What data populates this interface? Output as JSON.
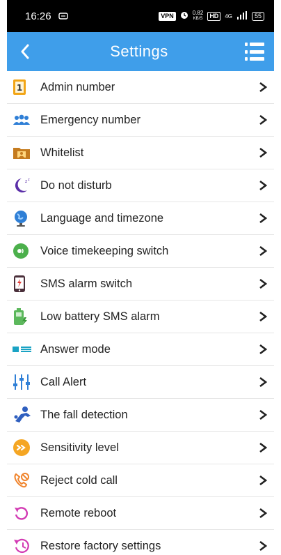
{
  "status_bar": {
    "time": "16:26",
    "vpn": "VPN",
    "speed_value": "0.82",
    "speed_unit": "KB/S",
    "hd": "HD",
    "network": "4G",
    "battery": "55"
  },
  "header": {
    "title": "Settings",
    "back_icon": "chevron-left-icon",
    "menu_icon": "list-menu-icon",
    "background": "#3f9eea"
  },
  "settings": [
    {
      "label": "Admin number",
      "icon": "admin-number-icon"
    },
    {
      "label": "Emergency number",
      "icon": "emergency-contacts-icon"
    },
    {
      "label": "Whitelist",
      "icon": "whitelist-folder-icon"
    },
    {
      "label": "Do not disturb",
      "icon": "moon-icon"
    },
    {
      "label": "Language and timezone",
      "icon": "globe-icon"
    },
    {
      "label": "Voice timekeeping switch",
      "icon": "voice-icon"
    },
    {
      "label": "SMS alarm switch",
      "icon": "phone-alarm-icon"
    },
    {
      "label": "Low battery SMS alarm",
      "icon": "low-battery-icon"
    },
    {
      "label": "Answer mode",
      "icon": "answer-mode-icon"
    },
    {
      "label": "Call Alert",
      "icon": "sliders-icon"
    },
    {
      "label": "The fall detection",
      "icon": "fall-person-icon"
    },
    {
      "label": "Sensitivity level",
      "icon": "sensitivity-icon"
    },
    {
      "label": "Reject cold call",
      "icon": "reject-call-icon"
    },
    {
      "label": "Remote reboot",
      "icon": "reboot-icon"
    },
    {
      "label": "Restore factory settings",
      "icon": "restore-clock-icon"
    }
  ],
  "chevron_icon": "chevron-right-icon"
}
